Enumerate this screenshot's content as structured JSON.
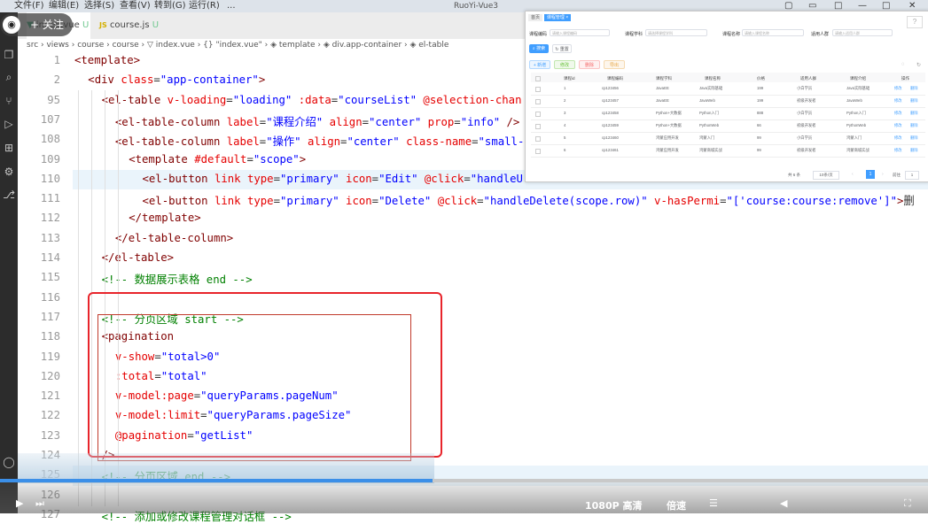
{
  "menu": [
    "文件(F)",
    "编辑(E)",
    "选择(S)",
    "查看(V)",
    "转到(G)",
    "运行(R)",
    "..."
  ],
  "window_title": "RuoYi-Vue3",
  "window_controls": [
    "▢",
    "▭",
    "□",
    "—",
    "□",
    "✕"
  ],
  "tabs": [
    {
      "label": "index.vue",
      "badge": "U",
      "active": true
    },
    {
      "label": "course.js",
      "badge": "U",
      "active": false
    }
  ],
  "tab_js_prefix": "JS",
  "follow_badge": "关注",
  "breadcrumb": "src › views › course › course › ▽ index.vue › {} \"index.vue\" › ◈ template › ◈ div.app-container › ◈ el-table",
  "editor_lines": [
    {
      "n": "1",
      "i": 0,
      "h": [
        [
          "tag",
          "<template>"
        ]
      ]
    },
    {
      "n": "2",
      "i": 1,
      "h": [
        [
          "tag",
          "<div "
        ],
        [
          "attr",
          "class"
        ],
        [
          "",
          "="
        ],
        [
          "str",
          "\"app-container\""
        ],
        [
          "tag",
          ">"
        ]
      ]
    },
    {
      "n": "95",
      "i": 2,
      "h": [
        [
          "tag",
          "<el-table "
        ],
        [
          "attr",
          "v-loading"
        ],
        [
          "",
          "="
        ],
        [
          "str",
          "\"loading\""
        ],
        [
          "",
          " "
        ],
        [
          "attr",
          ":data"
        ],
        [
          "",
          "="
        ],
        [
          "str",
          "\"courseList\""
        ],
        [
          "",
          " "
        ],
        [
          "attr",
          "@selection-chan"
        ]
      ]
    },
    {
      "n": "107",
      "i": 3,
      "h": [
        [
          "tag",
          "<el-table-column "
        ],
        [
          "attr",
          "label"
        ],
        [
          "",
          "="
        ],
        [
          "str",
          "\"课程介绍\""
        ],
        [
          "",
          " "
        ],
        [
          "attr",
          "align"
        ],
        [
          "",
          "="
        ],
        [
          "str",
          "\"center\""
        ],
        [
          "",
          " "
        ],
        [
          "attr",
          "prop"
        ],
        [
          "",
          "="
        ],
        [
          "str",
          "\"info\""
        ],
        [
          "tag",
          " />"
        ]
      ]
    },
    {
      "n": "108",
      "i": 3,
      "h": [
        [
          "tag",
          "<el-table-column "
        ],
        [
          "attr",
          "label"
        ],
        [
          "",
          "="
        ],
        [
          "str",
          "\"操作\""
        ],
        [
          "",
          " "
        ],
        [
          "attr",
          "align"
        ],
        [
          "",
          "="
        ],
        [
          "str",
          "\"center\""
        ],
        [
          "",
          " "
        ],
        [
          "attr",
          "class-name"
        ],
        [
          "",
          "="
        ],
        [
          "str",
          "\"small-"
        ]
      ]
    },
    {
      "n": "109",
      "i": 4,
      "h": [
        [
          "tag",
          "<template "
        ],
        [
          "attr",
          "#default"
        ],
        [
          "",
          "="
        ],
        [
          "str",
          "\"scope\""
        ],
        [
          "tag",
          ">"
        ]
      ]
    },
    {
      "n": "110",
      "i": 5,
      "h": [
        [
          "tag",
          "<el-button "
        ],
        [
          "attr",
          "link"
        ],
        [
          "",
          " "
        ],
        [
          "attr",
          "type"
        ],
        [
          "",
          "="
        ],
        [
          "str",
          "\"primary\""
        ],
        [
          "",
          " "
        ],
        [
          "attr",
          "icon"
        ],
        [
          "",
          "="
        ],
        [
          "str",
          "\"Edit\""
        ],
        [
          "",
          " "
        ],
        [
          "attr",
          "@click"
        ],
        [
          "",
          "="
        ],
        [
          "str",
          "\"handleU"
        ]
      ]
    },
    {
      "n": "111",
      "i": 5,
      "h": [
        [
          "tag",
          "<el-button "
        ],
        [
          "attr",
          "link"
        ],
        [
          "",
          " "
        ],
        [
          "attr",
          "type"
        ],
        [
          "",
          "="
        ],
        [
          "str",
          "\"primary\""
        ],
        [
          "",
          " "
        ],
        [
          "attr",
          "icon"
        ],
        [
          "",
          "="
        ],
        [
          "str",
          "\"Delete\""
        ],
        [
          "",
          " "
        ],
        [
          "attr",
          "@click"
        ],
        [
          "",
          "="
        ],
        [
          "str",
          "\"handleDelete(scope.row)\""
        ],
        [
          "",
          " "
        ],
        [
          "attr",
          "v-hasPermi"
        ],
        [
          "",
          "="
        ],
        [
          "str",
          "\"['course:course:remove']\""
        ],
        [
          "tag",
          ">"
        ],
        [
          "",
          "删"
        ]
      ]
    },
    {
      "n": "112",
      "i": 4,
      "h": [
        [
          "tag",
          "</template>"
        ]
      ]
    },
    {
      "n": "113",
      "i": 3,
      "h": [
        [
          "tag",
          "</el-table-column>"
        ]
      ]
    },
    {
      "n": "114",
      "i": 2,
      "h": [
        [
          "tag",
          "</el-table>"
        ]
      ]
    },
    {
      "n": "115",
      "i": 2,
      "h": [
        [
          "cmt",
          "<!-- 数据展示表格 end -->"
        ]
      ]
    },
    {
      "n": "116",
      "i": 0,
      "h": []
    },
    {
      "n": "117",
      "i": 2,
      "h": [
        [
          "cmt",
          "<!-- 分页区域 start -->"
        ]
      ]
    },
    {
      "n": "118",
      "i": 2,
      "h": [
        [
          "tag",
          "<pagination"
        ]
      ]
    },
    {
      "n": "119",
      "i": 3,
      "h": [
        [
          "attr",
          "v-show"
        ],
        [
          "",
          "="
        ],
        [
          "str",
          "\"total>0\""
        ]
      ]
    },
    {
      "n": "120",
      "i": 3,
      "h": [
        [
          "attr",
          ":total"
        ],
        [
          "",
          "="
        ],
        [
          "str",
          "\"total\""
        ]
      ]
    },
    {
      "n": "121",
      "i": 3,
      "h": [
        [
          "attr",
          "v-model:page"
        ],
        [
          "",
          "="
        ],
        [
          "str",
          "\"queryParams.pageNum\""
        ]
      ]
    },
    {
      "n": "122",
      "i": 3,
      "h": [
        [
          "attr",
          "v-model:limit"
        ],
        [
          "",
          "="
        ],
        [
          "str",
          "\"queryParams.pageSize\""
        ]
      ]
    },
    {
      "n": "123",
      "i": 3,
      "h": [
        [
          "attr",
          "@pagination"
        ],
        [
          "",
          "="
        ],
        [
          "str",
          "\"getList\""
        ]
      ]
    },
    {
      "n": "124",
      "i": 2,
      "h": [
        [
          "tag",
          "/>"
        ]
      ]
    },
    {
      "n": "125",
      "i": 2,
      "h": [
        [
          "cmt",
          "<!-- 分页区域 end -->"
        ]
      ]
    },
    {
      "n": "126",
      "i": 0,
      "h": []
    },
    {
      "n": "127",
      "i": 2,
      "h": [
        [
          "cmt",
          "<!-- 添加或修改课程管理对话框 -->"
        ]
      ]
    }
  ],
  "bottom_overlay": {
    "quality": "1080P 高清",
    "speed": "倍速"
  },
  "preview": {
    "tabs": [
      "首页",
      "课程管理 ×"
    ],
    "search": [
      {
        "label": "课程编码",
        "placeholder": "请输入课程编码"
      },
      {
        "label": "课程学科",
        "placeholder": "请选择课程学科"
      },
      {
        "label": "课程名称",
        "placeholder": "请输入课程名称"
      },
      {
        "label": "适用人群",
        "placeholder": "请输入适用人群"
      }
    ],
    "search_btn": "搜索",
    "reset_btn": "重置",
    "actions": [
      "+ 新增",
      "修改",
      "删除",
      "导出"
    ],
    "columns": [
      "课程id",
      "课程编码",
      "课程学科",
      "课程名称",
      "价格",
      "适用人群",
      "课程介绍",
      "操作"
    ],
    "rows": [
      [
        "1",
        "cp123456",
        "JavaEE",
        "Java实际基础",
        "199",
        "小白学员",
        "Java实际基础"
      ],
      [
        "2",
        "cp123457",
        "JavaEE",
        "JavaWeb",
        "199",
        "初级开发者",
        "JavaWeb"
      ],
      [
        "3",
        "cp123458",
        "Python+大数据",
        "Python入门",
        "888",
        "小白学员",
        "Python入门"
      ],
      [
        "4",
        "cp123459",
        "Python+大数据",
        "PythonWeb",
        "66",
        "初级开发者",
        "PythonWeb"
      ],
      [
        "5",
        "cp123460",
        "鸿蒙应用开发",
        "鸿蒙入门",
        "99",
        "小白学员",
        "鸿蒙入门"
      ],
      [
        "6",
        "cp123461",
        "鸿蒙应用开发",
        "鸿蒙商城实战",
        "99",
        "初级开发者",
        "鸿蒙商城实战"
      ]
    ],
    "op_edit": "修改",
    "op_delete": "删除",
    "pagination": {
      "total": "共 6 条",
      "size": "10条/页",
      "current": "1",
      "goto": "前往",
      "page": "1"
    }
  },
  "colors": {
    "tag": "#800000",
    "attr": "#e50000",
    "string": "#0000ff",
    "comment": "#008000",
    "highlight_box": "#e8242b",
    "primary": "#409eff"
  }
}
